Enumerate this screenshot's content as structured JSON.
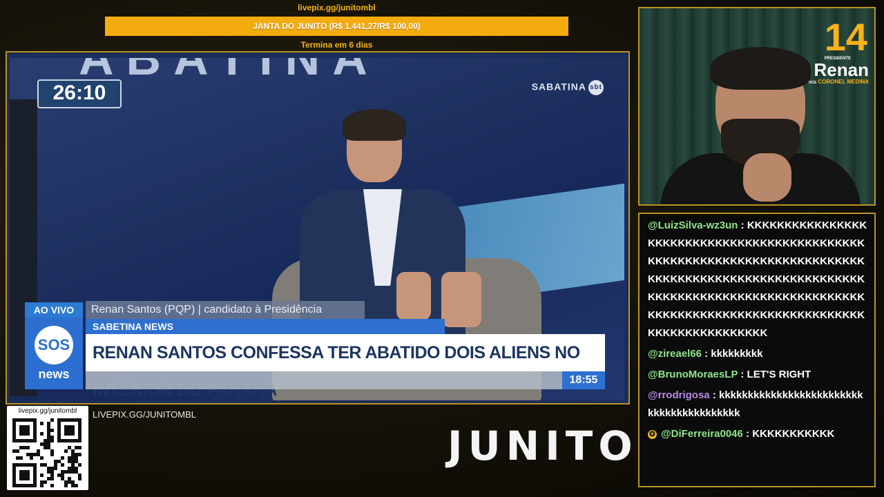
{
  "goal": {
    "url": "livepix.gg/junitombl",
    "title": "JANTA DO JUNITO (R$ 1.441,27/R$ 100,00)",
    "ends": "Termina em 6 dias"
  },
  "broadcast": {
    "timer": "26:10",
    "channel_logo": "SABATINA",
    "channel_badge": "sbt",
    "background_text": "ABATINA",
    "live_label": "AO VIVO",
    "news_logo_top": "SOS",
    "news_logo_bottom": "news",
    "guest_caption": "Renan Santos (PQP) | candidato à Presidência",
    "program_name": "SABETINA NEWS",
    "headline": "RENAN SANTOS CONFESSA TER ABATIDO DOIS ALIENS NO INTERIOR DO PARANÁ",
    "clock": "18:55"
  },
  "webcam": {
    "overlay_number": "14",
    "overlay_role": "PRESIDENTE",
    "overlay_name": "Renan",
    "overlay_vice_label": "VICE",
    "overlay_vice": "CORONEL MEDINA"
  },
  "chat": {
    "messages": [
      {
        "user": "@LuizSilva-wz3un",
        "sep": " : ",
        "text": "KKKKKKKKKKKKKKKKKKKKKKKKKKKKKKKKKKKKKKKKKKKKKKKKKKKKKKKKKKKKKKKKKKKKKKKKKKKKKKKKKKKKKKKKKKKKKKKKKKKKKKKKKKKKKKKKKKKKKKKKKKKKKKKKKKKKKKKKKKKKKKKKKKKKKKKKKKKKKKKKKKKKKKKKKKKKKKKKK"
      },
      {
        "user": "@zireael66",
        "sep": " : ",
        "text": "kkkkkkkkk"
      },
      {
        "user": "@BrunoMoraesLP",
        "sep": " : ",
        "text": "LET'S RIGHT"
      },
      {
        "user": "@rrodrigosa",
        "sep": " : ",
        "text": "kkkkkkkkkkkkkkkkkkkkkkkkkkkkkkkkkkkkkkkkk"
      },
      {
        "user": "@DiFerreira0046",
        "sep": " : ",
        "text": "KKKKKKKKKKK"
      }
    ],
    "user_colors": [
      "#8ee68a",
      "#8ee68a",
      "#8ee68a",
      "#b98ae6",
      "#8ee68a"
    ]
  },
  "footer": {
    "qr_url": "livepix.gg/junitombl",
    "livepix_label": "LIVEPIX.GG/JUNITOMBL",
    "brand": "JUNITO"
  }
}
